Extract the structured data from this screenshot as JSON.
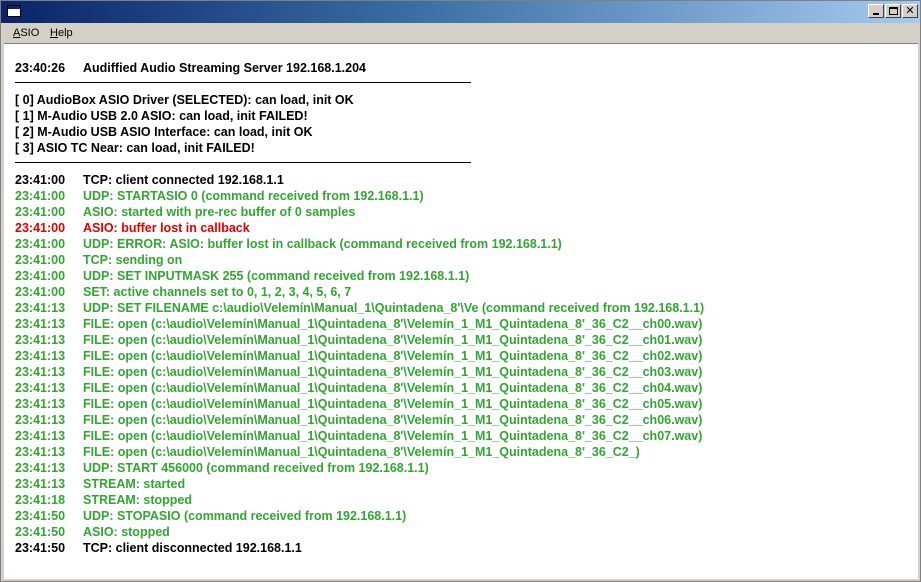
{
  "window": {
    "title": ""
  },
  "menu": {
    "items": [
      {
        "label": "ASIO",
        "accel": "A",
        "rest": "SIO"
      },
      {
        "label": "Help",
        "accel": "H",
        "rest": "elp"
      }
    ]
  },
  "header": {
    "time": "23:40:26",
    "text": "Audiffied Audio Streaming Server 192.168.1.204"
  },
  "devices": [
    "[ 0] AudioBox ASIO Driver (SELECTED): can load, init OK",
    "[ 1] M-Audio USB 2.0 ASIO: can load, init FAILED!",
    "[ 2] M-Audio USB ASIO Interface: can load, init OK",
    "[ 3] ASIO TC Near: can load, init FAILED!"
  ],
  "colors": {
    "green": "#33a533",
    "red": "#e00000",
    "black": "#000000"
  },
  "log": [
    {
      "time": "23:41:00",
      "text": "TCP: client connected 192.168.1.1",
      "color": "black"
    },
    {
      "time": "23:41:00",
      "text": "UDP: STARTASIO 0 (command received from 192.168.1.1)",
      "color": "green"
    },
    {
      "time": "23:41:00",
      "text": "ASIO: started with pre-rec buffer of 0 samples",
      "color": "green"
    },
    {
      "time": "23:41:00",
      "text": "ASIO: buffer lost in callback",
      "color": "red"
    },
    {
      "time": "23:41:00",
      "text": "UDP: ERROR: ASIO: buffer lost in callback (command received from 192.168.1.1)",
      "color": "green"
    },
    {
      "time": "23:41:00",
      "text": "TCP: sending on",
      "color": "green"
    },
    {
      "time": "23:41:00",
      "text": "UDP: SET INPUTMASK 255 (command received from 192.168.1.1)",
      "color": "green"
    },
    {
      "time": "23:41:00",
      "text": "SET: active channels set to 0, 1, 2, 3, 4, 5, 6, 7",
      "color": "green"
    },
    {
      "time": "23:41:13",
      "text": "UDP: SET FILENAME c:\\audio\\Velemín\\Manual_1\\Quintadena_8'\\Ve (command received from 192.168.1.1)",
      "color": "green"
    },
    {
      "time": "23:41:13",
      "text": "FILE: open (c:\\audio\\Velemín\\Manual_1\\Quintadena_8'\\Velemín_1_M1_Quintadena_8'_36_C2__ch00.wav)",
      "color": "green"
    },
    {
      "time": "23:41:13",
      "text": "FILE: open (c:\\audio\\Velemín\\Manual_1\\Quintadena_8'\\Velemín_1_M1_Quintadena_8'_36_C2__ch01.wav)",
      "color": "green"
    },
    {
      "time": "23:41:13",
      "text": "FILE: open (c:\\audio\\Velemín\\Manual_1\\Quintadena_8'\\Velemín_1_M1_Quintadena_8'_36_C2__ch02.wav)",
      "color": "green"
    },
    {
      "time": "23:41:13",
      "text": "FILE: open (c:\\audio\\Velemín\\Manual_1\\Quintadena_8'\\Velemín_1_M1_Quintadena_8'_36_C2__ch03.wav)",
      "color": "green"
    },
    {
      "time": "23:41:13",
      "text": "FILE: open (c:\\audio\\Velemín\\Manual_1\\Quintadena_8'\\Velemín_1_M1_Quintadena_8'_36_C2__ch04.wav)",
      "color": "green"
    },
    {
      "time": "23:41:13",
      "text": "FILE: open (c:\\audio\\Velemín\\Manual_1\\Quintadena_8'\\Velemín_1_M1_Quintadena_8'_36_C2__ch05.wav)",
      "color": "green"
    },
    {
      "time": "23:41:13",
      "text": "FILE: open (c:\\audio\\Velemín\\Manual_1\\Quintadena_8'\\Velemín_1_M1_Quintadena_8'_36_C2__ch06.wav)",
      "color": "green"
    },
    {
      "time": "23:41:13",
      "text": "FILE: open (c:\\audio\\Velemín\\Manual_1\\Quintadena_8'\\Velemín_1_M1_Quintadena_8'_36_C2__ch07.wav)",
      "color": "green"
    },
    {
      "time": "23:41:13",
      "text": "FILE: open (c:\\audio\\Velemín\\Manual_1\\Quintadena_8'\\Velemín_1_M1_Quintadena_8'_36_C2_)",
      "color": "green"
    },
    {
      "time": "23:41:13",
      "text": "UDP: START 456000 (command received from 192.168.1.1)",
      "color": "green"
    },
    {
      "time": "23:41:13",
      "text": "STREAM: started",
      "color": "green"
    },
    {
      "time": "23:41:18",
      "text": "STREAM: stopped",
      "color": "green"
    },
    {
      "time": "23:41:50",
      "text": "UDP: STOPASIO (command received from 192.168.1.1)",
      "color": "green"
    },
    {
      "time": "23:41:50",
      "text": "ASIO: stopped",
      "color": "green"
    },
    {
      "time": "23:41:50",
      "text": "TCP: client disconnected 192.168.1.1",
      "color": "black"
    }
  ]
}
